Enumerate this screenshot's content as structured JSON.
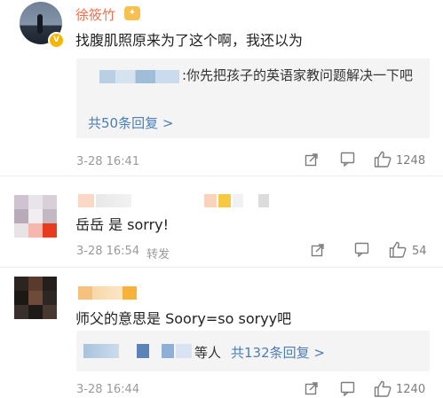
{
  "comments": [
    {
      "author": "徐筱竹",
      "text": "找腹肌照原来为了这个啊，我还以为",
      "reply": {
        "text": ":你先把孩子的英语家教问题解决一下吧",
        "count": "共50条回复 >"
      },
      "time": "3-28 16:41",
      "likes": "1248"
    },
    {
      "text": "岳岳 是 sorry!",
      "time": "3-28 16:54",
      "forward": "转发",
      "likes": "54"
    },
    {
      "text": "师父的意思是 Soory=so soryy吧",
      "reply": {
        "suffix": "等人",
        "count": "共132条回复 >"
      },
      "time": "3-28 16:44",
      "likes": "1240"
    }
  ],
  "colors": {
    "author": "#eb7350",
    "link": "#4a7eb5",
    "meta": "#9a9a9a",
    "reply_bg": "#f4f4f4"
  },
  "icons": [
    "vip-badge-icon",
    "level-icon",
    "share-icon",
    "comment-icon",
    "like-icon"
  ]
}
